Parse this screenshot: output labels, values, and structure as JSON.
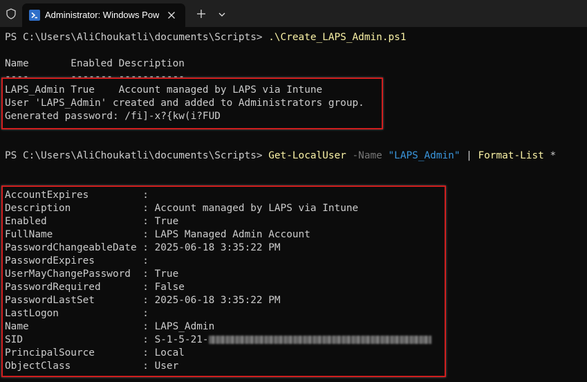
{
  "tab": {
    "title": "Administrator: Windows PowerShell"
  },
  "icons": {
    "shield": "shield-icon",
    "powershell": "powershell-icon",
    "close": "close-icon",
    "new_tab": "plus-icon",
    "dropdown": "chevron-down-icon"
  },
  "colors": {
    "highlight": "#d01e1e",
    "command": "#f9f1a5",
    "string": "#3a96dd",
    "parameter": "#767676",
    "text": "#cccccc"
  },
  "terminal": {
    "prompt1": {
      "path": "PS C:\\Users\\AliChoukatli\\documents\\Scripts> ",
      "command": ".\\Create_LAPS_Admin.ps1"
    },
    "table_header": "Name       Enabled Description",
    "table_rule": "----       ------- -----------",
    "output_lines": [
      "LAPS_Admin True    Account managed by LAPS via Intune",
      "User 'LAPS_Admin' created and added to Administrators group.",
      "Generated password: /fi]-x?{kw(i?FUD"
    ],
    "prompt2": {
      "path": "PS C:\\Users\\AliChoukatli\\documents\\Scripts> ",
      "cmdlet": "Get-LocalUser",
      "param": " -Name ",
      "value": "\"LAPS_Admin\"",
      "pipe": " | ",
      "cmdlet2": "Format-List",
      "arg": " *"
    },
    "properties": [
      {
        "name": "AccountExpires",
        "value": ""
      },
      {
        "name": "Description",
        "value": "Account managed by LAPS via Intune"
      },
      {
        "name": "Enabled",
        "value": "True"
      },
      {
        "name": "FullName",
        "value": "LAPS Managed Admin Account"
      },
      {
        "name": "PasswordChangeableDate",
        "value": "2025-06-18 3:35:22 PM"
      },
      {
        "name": "PasswordExpires",
        "value": ""
      },
      {
        "name": "UserMayChangePassword",
        "value": "True"
      },
      {
        "name": "PasswordRequired",
        "value": "False"
      },
      {
        "name": "PasswordLastSet",
        "value": "2025-06-18 3:35:22 PM"
      },
      {
        "name": "LastLogon",
        "value": ""
      },
      {
        "name": "Name",
        "value": "LAPS_Admin"
      },
      {
        "name": "SID",
        "value": "S-1-5-21-"
      },
      {
        "name": "PrincipalSource",
        "value": "Local"
      },
      {
        "name": "ObjectClass",
        "value": "User"
      }
    ]
  }
}
